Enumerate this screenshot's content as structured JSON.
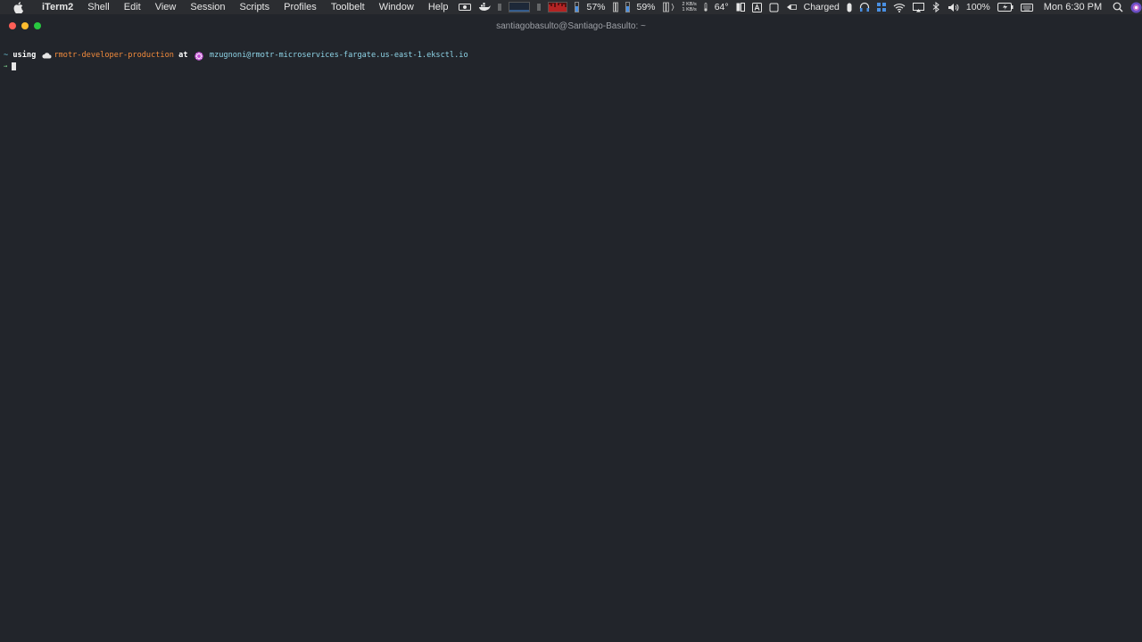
{
  "menubar": {
    "items": [
      {
        "label": "iTerm2",
        "app": true
      },
      {
        "label": "Shell"
      },
      {
        "label": "Edit"
      },
      {
        "label": "View"
      },
      {
        "label": "Session"
      },
      {
        "label": "Scripts"
      },
      {
        "label": "Profiles"
      },
      {
        "label": "Toolbelt"
      },
      {
        "label": "Window"
      },
      {
        "label": "Help"
      }
    ],
    "status": {
      "cpu_percent": "57%",
      "mem_percent": "59%",
      "net_up": "2 KB/s",
      "net_down": "1 KB/s",
      "temperature": "64°",
      "power_status": "Charged",
      "battery_percent": "100%",
      "clock": "Mon 6:30 PM"
    }
  },
  "window": {
    "title": "santiagobasulto@Santiago-Basulto: ~"
  },
  "terminal": {
    "prompt_tilde": "~",
    "using_word": "using",
    "context_name": "rmotr-developer-production",
    "at_word": "at",
    "cluster_name": "mzugnoni@rmotr-microservices-fargate.us-east-1.eksctl.io",
    "second_prompt": "→"
  },
  "colors": {
    "background": "#22252b",
    "context": "#f28b3c",
    "cluster": "#8fd5e8",
    "close": "#fe5f57",
    "minimize": "#febc2e",
    "maximize": "#28c840"
  }
}
